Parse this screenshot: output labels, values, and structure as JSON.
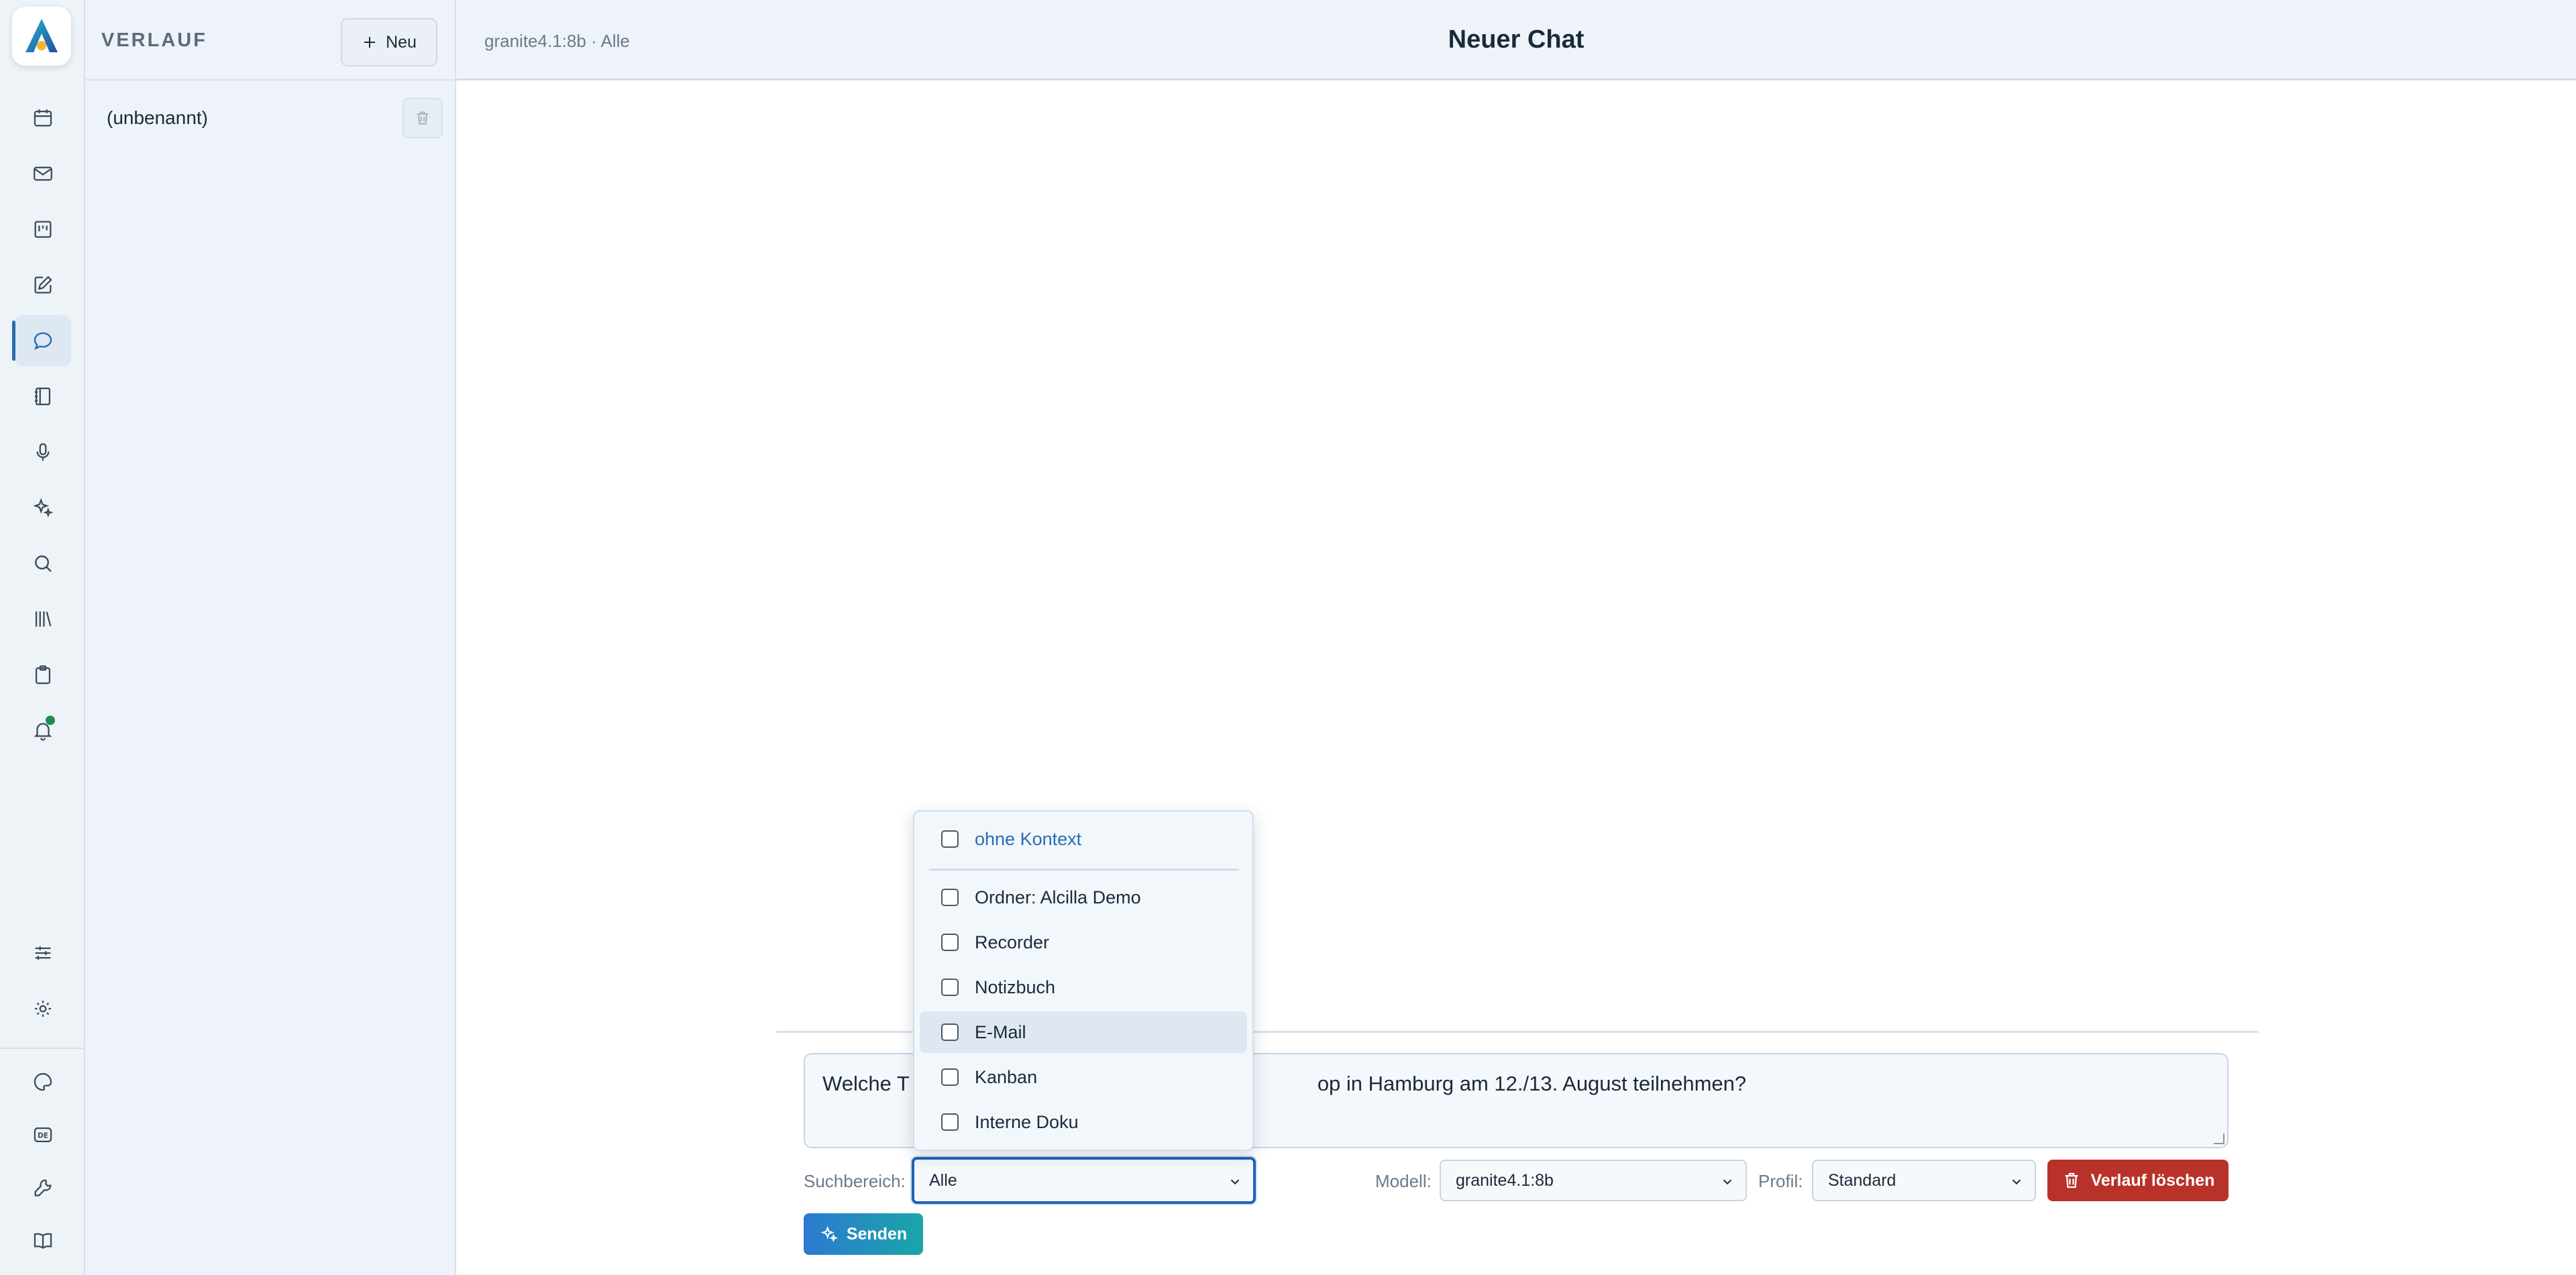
{
  "app": {
    "title": "Neuer Chat"
  },
  "rail": {
    "items": [
      {
        "icon": "calendar-icon"
      },
      {
        "icon": "mail-icon"
      },
      {
        "icon": "kanban-icon"
      },
      {
        "icon": "edit-icon"
      },
      {
        "icon": "chat-icon",
        "active": true
      },
      {
        "icon": "notebook-icon"
      },
      {
        "icon": "microphone-icon"
      },
      {
        "icon": "sparkles-icon"
      },
      {
        "icon": "search-icon"
      },
      {
        "icon": "library-icon"
      },
      {
        "icon": "clipboard-icon"
      },
      {
        "icon": "bell-icon",
        "notification": true
      },
      {
        "icon": "sliders-icon"
      },
      {
        "icon": "settings-icon"
      },
      {
        "icon": "palette-icon"
      },
      {
        "icon": "language-de-icon"
      },
      {
        "icon": "wrench-icon"
      },
      {
        "icon": "book-icon"
      }
    ],
    "language_badge": "DE"
  },
  "history": {
    "title": "VERLAUF",
    "new_label": "Neu",
    "items": [
      {
        "label": "(unbenannt)"
      }
    ]
  },
  "header": {
    "crumb": "granite4.1:8b · Alle",
    "title": "Neuer Chat"
  },
  "composer": {
    "prompt_left": "Welche T",
    "prompt_right": "op in Hamburg am 12./13. August teilnehmen?",
    "scope_label": "Suchbereich:",
    "scope_value": "Alle",
    "model_label": "Modell:",
    "model_value": "granite4.1:8b",
    "profile_label": "Profil:",
    "profile_value": "Standard",
    "clear_label": "Verlauf löschen",
    "send_label": "Senden"
  },
  "scope_dropdown": {
    "no_context": "ohne Kontext",
    "options": [
      "Ordner: Alcilla Demo",
      "Recorder",
      "Notizbuch",
      "E-Mail",
      "Kanban",
      "Interne Doku"
    ],
    "hovered": "E-Mail"
  },
  "colors": {
    "accent": "#2a6db0",
    "danger": "#b8322a",
    "send_gradient_start": "#2c79d1",
    "send_gradient_end": "#1aa6a8",
    "notification": "#1e8f4a"
  }
}
